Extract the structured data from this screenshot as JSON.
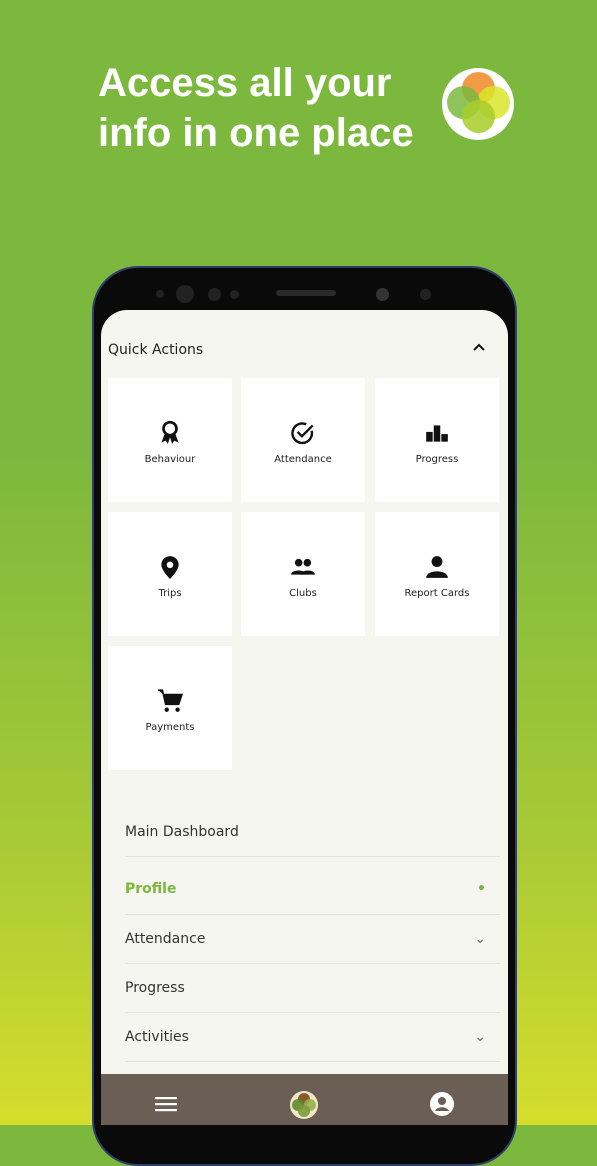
{
  "headline": "Access all your info in one place",
  "colors": {
    "accent": "#7cb83e",
    "bottom_bar": "#6b5e55"
  },
  "quick_actions": {
    "title": "Quick Actions",
    "collapse_icon": "chevron-up-icon",
    "tiles": [
      {
        "label": "Behaviour",
        "icon": "award-icon"
      },
      {
        "label": "Attendance",
        "icon": "check-circle-icon"
      },
      {
        "label": "Progress",
        "icon": "podium-icon"
      },
      {
        "label": "Trips",
        "icon": "location-pin-icon"
      },
      {
        "label": "Clubs",
        "icon": "people-icon"
      },
      {
        "label": "Report Cards",
        "icon": "person-icon"
      },
      {
        "label": "Payments",
        "icon": "cart-icon"
      }
    ]
  },
  "menu": [
    {
      "label": "Main Dashboard"
    },
    {
      "label": "Profile",
      "active": true,
      "indicator": "•"
    },
    {
      "label": "Attendance",
      "indicator": "⌄"
    },
    {
      "label": "Progress"
    },
    {
      "label": "Activities",
      "indicator": "⌄"
    }
  ],
  "bottom_nav": [
    "menu-icon",
    "home-logo-icon",
    "account-icon"
  ]
}
